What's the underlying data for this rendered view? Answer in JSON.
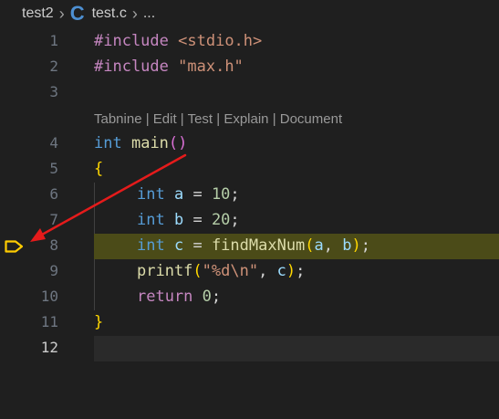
{
  "breadcrumb": {
    "folder": "test2",
    "file": "test.c",
    "more": "...",
    "file_icon_glyph": "C"
  },
  "editor": {
    "codelens": "Tabnine | Edit | Test | Explain | Document",
    "line_numbers": [
      "1",
      "2",
      "3",
      "4",
      "5",
      "6",
      "7",
      "8",
      "9",
      "10",
      "11",
      "12"
    ],
    "lines": {
      "l1": {
        "kw": "#include",
        "arg": "<stdio.h>"
      },
      "l2": {
        "kw": "#include",
        "arg": "\"max.h\""
      },
      "l4": {
        "type": "int",
        "name": "main",
        "paren": "()"
      },
      "l5": {
        "brace": "{"
      },
      "l6": {
        "type": "int",
        "var": "a",
        "op": " = ",
        "num": "10",
        "end": ";"
      },
      "l7": {
        "type": "int",
        "var": "b",
        "op": " = ",
        "num": "20",
        "end": ";"
      },
      "l8": {
        "type": "int",
        "var": "c",
        "op": " = ",
        "fn": "findMaxNum",
        "open": "(",
        "a": "a",
        "sep": ", ",
        "b": "b",
        "close": ")",
        "end": ";"
      },
      "l9": {
        "fn": "printf",
        "open": "(",
        "str": "\"%d\\n\"",
        "sep": ", ",
        "var": "c",
        "close": ")",
        "end": ";"
      },
      "l10": {
        "kw": "return",
        "num": "0",
        "end": ";"
      },
      "l11": {
        "brace": "}"
      }
    }
  },
  "colors": {
    "background": "#1f1f1f",
    "highlight_line": "#4b4b18",
    "breakpoint": "#ffcc00",
    "arrow": "#e51b1b"
  },
  "icons": {
    "breakpoint": "debug-current-line-marker-icon",
    "annotation": "red-arrow"
  }
}
